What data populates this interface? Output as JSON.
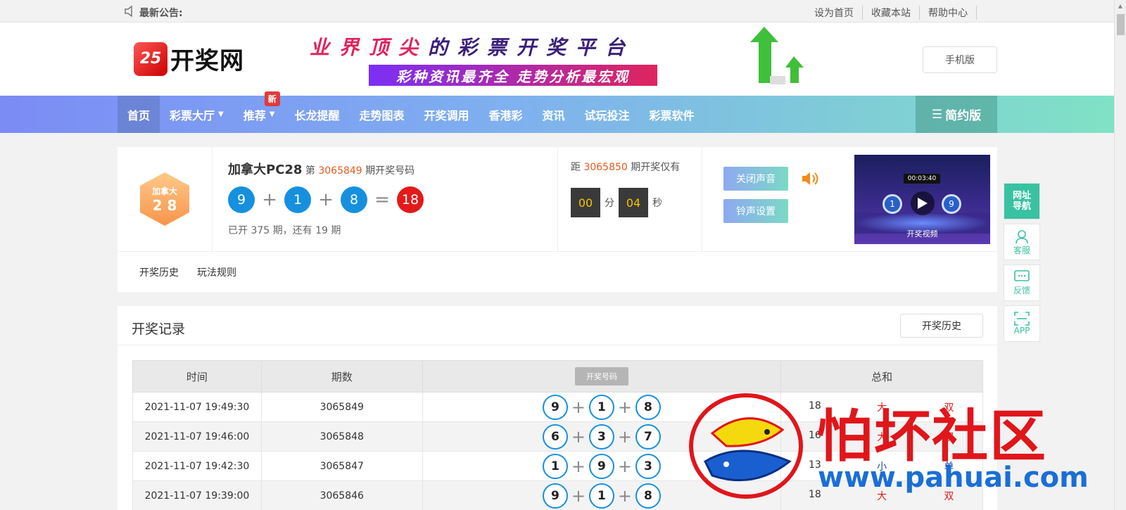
{
  "topbar": {
    "notice_label": "最新公告:",
    "links": [
      "设为首页",
      "收藏本站",
      "帮助中心"
    ]
  },
  "header": {
    "logo_badge": "25",
    "logo_text": "开奖网",
    "banner_top_a": "业界顶尖",
    "banner_top_b": "的彩票开奖平台",
    "banner_bottom": "彩种资讯最齐全  走势分析最宏观",
    "mobile_label": "手机版"
  },
  "nav": {
    "items": [
      {
        "label": "首页"
      },
      {
        "label": "彩票大厅"
      },
      {
        "label": "推荐"
      },
      {
        "label": "长龙提醒"
      },
      {
        "label": "走势图表"
      },
      {
        "label": "开奖调用"
      },
      {
        "label": "香港彩"
      },
      {
        "label": "资讯"
      },
      {
        "label": "试玩投注"
      },
      {
        "label": "彩票软件"
      }
    ],
    "new_badge": "新",
    "simple_label": "简约版"
  },
  "draw": {
    "logo_top": "加拿大",
    "logo_bottom": "2 8",
    "name": "加拿大PC28",
    "prefix": "第",
    "issue": "3065849",
    "suffix": "期开奖号码",
    "numbers": [
      "9",
      "1",
      "8"
    ],
    "sum": "18",
    "opened_text": "已开 375 期，还有 19 期",
    "next_prefix": "距",
    "next_issue": "3065850",
    "next_suffix": "期开奖仅有",
    "minutes": "00",
    "min_unit": "分",
    "seconds": "04",
    "sec_unit": "秒",
    "sound_btn": "关闭声音",
    "ring_btn": "铃声设置",
    "video_caption": "开奖视频",
    "video_timer": "00:03:40"
  },
  "tabs": [
    "开奖历史",
    "玩法规则"
  ],
  "record": {
    "title": "开奖记录",
    "history_btn": "开奖历史",
    "headers": {
      "time": "时间",
      "issue": "期数",
      "numbers": "开奖号码",
      "sum": "总和"
    },
    "rows": [
      {
        "time": "2021-11-07 19:49:30",
        "issue": "3065849",
        "n": [
          "9",
          "1",
          "8"
        ],
        "sum": "18",
        "size": "大",
        "parity": "双"
      },
      {
        "time": "2021-11-07 19:46:00",
        "issue": "3065848",
        "n": [
          "6",
          "3",
          "7"
        ],
        "sum": "16",
        "size": "大",
        "parity": "双"
      },
      {
        "time": "2021-11-07 19:42:30",
        "issue": "3065847",
        "n": [
          "1",
          "9",
          "3"
        ],
        "sum": "13",
        "size": "小",
        "parity": "单"
      },
      {
        "time": "2021-11-07 19:39:00",
        "issue": "3065846",
        "n": [
          "9",
          "1",
          "8"
        ],
        "sum": "18",
        "size": "大",
        "parity": "双"
      }
    ]
  },
  "side": {
    "nav_label": "网址导航",
    "service_label": "客服",
    "feedback_label": "反馈",
    "app_label": "APP"
  },
  "watermark": {
    "cn": "怕坏社区",
    "url": "www.pahuai.com"
  },
  "colors": {
    "accent_blue": "#1690de",
    "accent_red": "#e21a1a",
    "highlight_orange": "#e85a1c",
    "nav_start": "#7b8cf5",
    "nav_end": "#7fe3c4",
    "side_green": "#38c2a1"
  }
}
